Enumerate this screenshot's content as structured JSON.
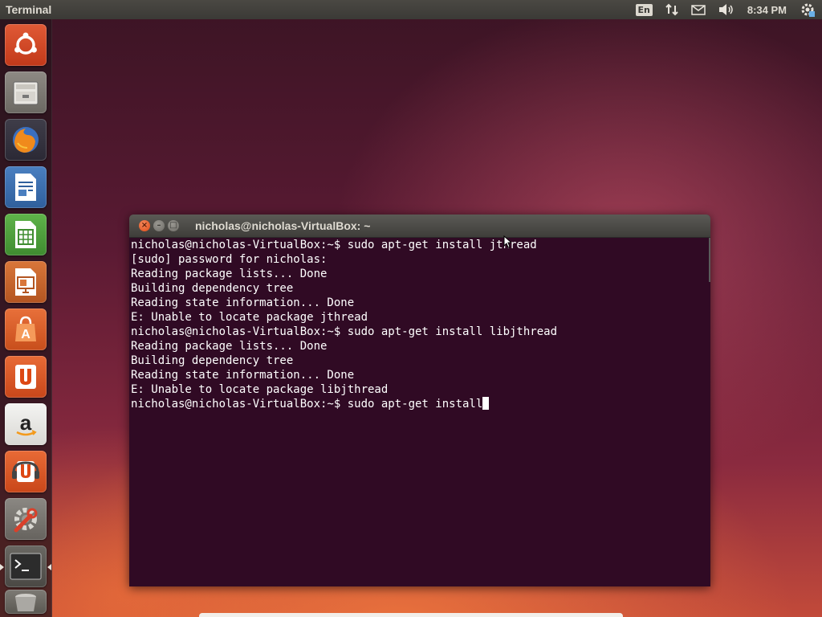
{
  "top_panel": {
    "app_title": "Terminal",
    "keyboard_layout": "En",
    "clock": "8:34 PM",
    "icons": [
      "network-icon",
      "mail-icon",
      "volume-icon",
      "settings-gear-icon"
    ]
  },
  "launcher": {
    "items": [
      {
        "name": "dash-home",
        "icon": "ubuntu-logo-icon"
      },
      {
        "name": "files",
        "icon": "file-cabinet-icon"
      },
      {
        "name": "firefox",
        "icon": "firefox-icon"
      },
      {
        "name": "libreoffice-writer",
        "icon": "writer-icon"
      },
      {
        "name": "libreoffice-calc",
        "icon": "calc-icon"
      },
      {
        "name": "libreoffice-impress",
        "icon": "impress-icon"
      },
      {
        "name": "software-center",
        "icon": "software-center-icon"
      },
      {
        "name": "ubuntu-one",
        "icon": "ubuntu-one-icon"
      },
      {
        "name": "amazon",
        "icon": "amazon-icon"
      },
      {
        "name": "ubuntu-one-music",
        "icon": "music-store-icon"
      },
      {
        "name": "system-settings",
        "icon": "settings-wrench-icon"
      },
      {
        "name": "terminal",
        "icon": "terminal-icon"
      },
      {
        "name": "trash",
        "icon": "trash-icon"
      }
    ]
  },
  "terminal": {
    "window_title": "nicholas@nicholas-VirtualBox: ~",
    "close_glyph": "×",
    "min_glyph": "–",
    "max_glyph": "□",
    "lines": [
      "nicholas@nicholas-VirtualBox:~$ sudo apt-get install jthread",
      "[sudo] password for nicholas:",
      "Reading package lists... Done",
      "Building dependency tree",
      "Reading state information... Done",
      "E: Unable to locate package jthread",
      "nicholas@nicholas-VirtualBox:~$ sudo apt-get install libjthread",
      "Reading package lists... Done",
      "Building dependency tree",
      "Reading state information... Done",
      "E: Unable to locate package libjthread",
      "nicholas@nicholas-VirtualBox:~$ sudo apt-get install"
    ]
  },
  "colors": {
    "terminal_bg": "#300a24",
    "panel_bg": "#3b3a36",
    "accent_orange": "#df4a16"
  }
}
